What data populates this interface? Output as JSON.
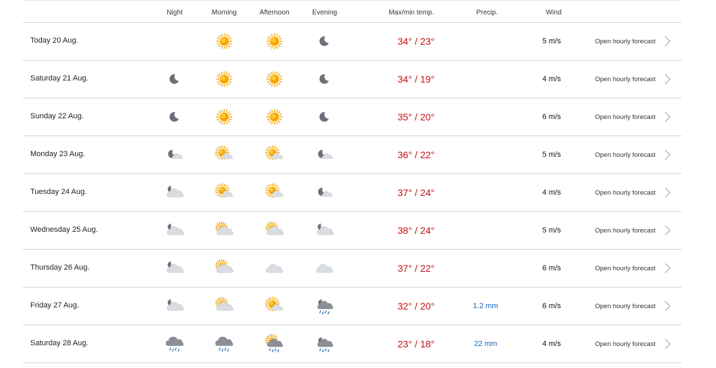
{
  "header": {
    "night": "Night",
    "morning": "Morning",
    "afternoon": "Afternoon",
    "evening": "Evening",
    "temp": "Max/min temp.",
    "precip": "Precip.",
    "wind": "Wind"
  },
  "colors": {
    "temp": "#c60f0f",
    "precip": "#1565c0",
    "sun": "#f5a500",
    "moon": "#6e6e78",
    "cloud": "#d9dde2",
    "rain_cloud": "#8c9096",
    "rain": "#2a6fb8"
  },
  "rows": [
    {
      "date": "Today 20 Aug.",
      "night": "",
      "morning": "sun",
      "afternoon": "sun",
      "evening": "moon",
      "temp": "34° / 23°",
      "precip": "",
      "wind": "5 m/s",
      "link": "Open hourly forecast"
    },
    {
      "date": "Saturday 21 Aug.",
      "night": "moon",
      "morning": "sun",
      "afternoon": "sun",
      "evening": "moon",
      "temp": "34° / 19°",
      "precip": "",
      "wind": "4 m/s",
      "link": "Open hourly forecast"
    },
    {
      "date": "Sunday 22 Aug.",
      "night": "moon",
      "morning": "sun",
      "afternoon": "sun",
      "evening": "moon",
      "temp": "35° / 20°",
      "precip": "",
      "wind": "6 m/s",
      "link": "Open hourly forecast"
    },
    {
      "date": "Monday 23 Aug.",
      "night": "moon-cloud",
      "morning": "sun-cloud",
      "afternoon": "sun-cloud",
      "evening": "moon-cloud",
      "temp": "36° / 22°",
      "precip": "",
      "wind": "5 m/s",
      "link": "Open hourly forecast"
    },
    {
      "date": "Tuesday 24 Aug.",
      "night": "cloud-moon",
      "morning": "sun-cloud",
      "afternoon": "sun-cloud",
      "evening": "moon-cloud",
      "temp": "37° / 24°",
      "precip": "",
      "wind": "4 m/s",
      "link": "Open hourly forecast"
    },
    {
      "date": "Wednesday 25 Aug.",
      "night": "cloud-moon",
      "morning": "cloud-sun",
      "afternoon": "cloud-sun",
      "evening": "cloud-moon",
      "temp": "38° / 24°",
      "precip": "",
      "wind": "5 m/s",
      "link": "Open hourly forecast"
    },
    {
      "date": "Thursday 26 Aug.",
      "night": "cloud-moon",
      "morning": "cloud-sun",
      "afternoon": "cloud",
      "evening": "cloud",
      "temp": "37° / 22°",
      "precip": "",
      "wind": "6 m/s",
      "link": "Open hourly forecast"
    },
    {
      "date": "Friday 27 Aug.",
      "night": "cloud-moon",
      "morning": "cloud-sun",
      "afternoon": "sun-cloud",
      "evening": "moon-rain",
      "temp": "32° / 20°",
      "precip": "1.2 mm",
      "wind": "6 m/s",
      "link": "Open hourly forecast"
    },
    {
      "date": "Saturday 28 Aug.",
      "night": "rain-cloud",
      "morning": "rain-cloud",
      "afternoon": "sun-rain",
      "evening": "moon-rain",
      "temp": "23° / 18°",
      "precip": "22 mm",
      "wind": "4 m/s",
      "link": "Open hourly forecast"
    }
  ]
}
